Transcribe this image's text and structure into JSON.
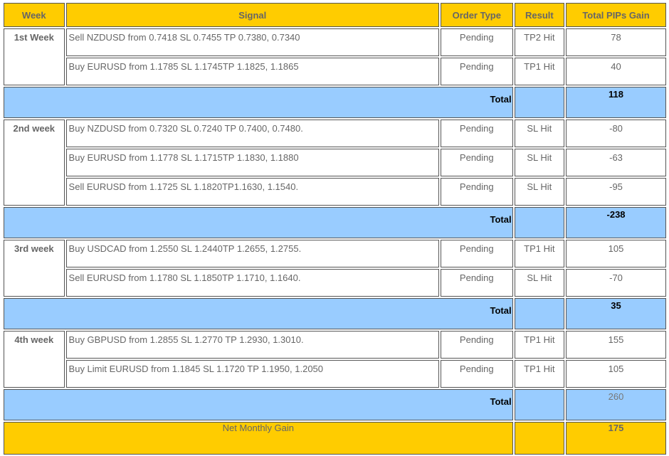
{
  "headers": {
    "week": "Week",
    "signal": "Signal",
    "order_type": "Order Type",
    "result": "Result",
    "total_pips": "Total PIPs Gain"
  },
  "weeks": [
    {
      "label": "1st Week",
      "rows": [
        {
          "signal": "Sell NZDUSD from 0.7418 SL 0.7455 TP 0.7380, 0.7340",
          "order_type": "Pending",
          "result": "TP2 Hit",
          "pips": "78"
        },
        {
          "signal": "Buy EURUSD from 1.1785 SL 1.1745TP 1.1825, 1.1865",
          "order_type": "Pending",
          "result": "TP1 Hit",
          "pips": "40"
        }
      ],
      "total_label": "Total",
      "total": "118"
    },
    {
      "label": "2nd week",
      "rows": [
        {
          "signal": "Buy NZDUSD from 0.7320 SL 0.7240 TP 0.7400, 0.7480.",
          "order_type": "Pending",
          "result": "SL Hit",
          "pips": "-80"
        },
        {
          "signal": "Buy EURUSD from 1.1778 SL 1.1715TP 1.1830, 1.1880",
          "order_type": "Pending",
          "result": "SL Hit",
          "pips": "-63"
        },
        {
          "signal": "Sell EURUSD from 1.1725 SL 1.1820TP1.1630, 1.1540.",
          "order_type": "Pending",
          "result": "SL Hit",
          "pips": "-95"
        }
      ],
      "total_label": "Total",
      "total": "-238"
    },
    {
      "label": "3rd week",
      "rows": [
        {
          "signal": "Buy USDCAD from 1.2550 SL 1.2440TP 1.2655, 1.2755.",
          "order_type": "Pending",
          "result": "TP1 Hit",
          "pips": "105"
        },
        {
          "signal": "Sell EURUSD from 1.1780 SL 1.1850TP 1.1710, 1.1640.",
          "order_type": "Pending",
          "result": "SL Hit",
          "pips": "-70"
        }
      ],
      "total_label": "Total",
      "total": "35"
    },
    {
      "label": "4th week",
      "rows": [
        {
          "signal": "Buy GBPUSD from 1.2855 SL 1.2770 TP 1.2930, 1.3010.",
          "order_type": "Pending",
          "result": "TP1 Hit",
          "pips": "155"
        },
        {
          "signal": "Buy Limit EURUSD from 1.1845 SL 1.1720 TP 1.1950, 1.2050",
          "order_type": "Pending",
          "result": "TP1 Hit",
          "pips": "105"
        }
      ],
      "total_label": "Total",
      "total": "260"
    }
  ],
  "net": {
    "label": "Net Monthly Gain",
    "value": "175"
  },
  "colors": {
    "header_bg": "#ffcc00",
    "total_bg": "#99ccff",
    "net_bg": "#ffcc00"
  }
}
